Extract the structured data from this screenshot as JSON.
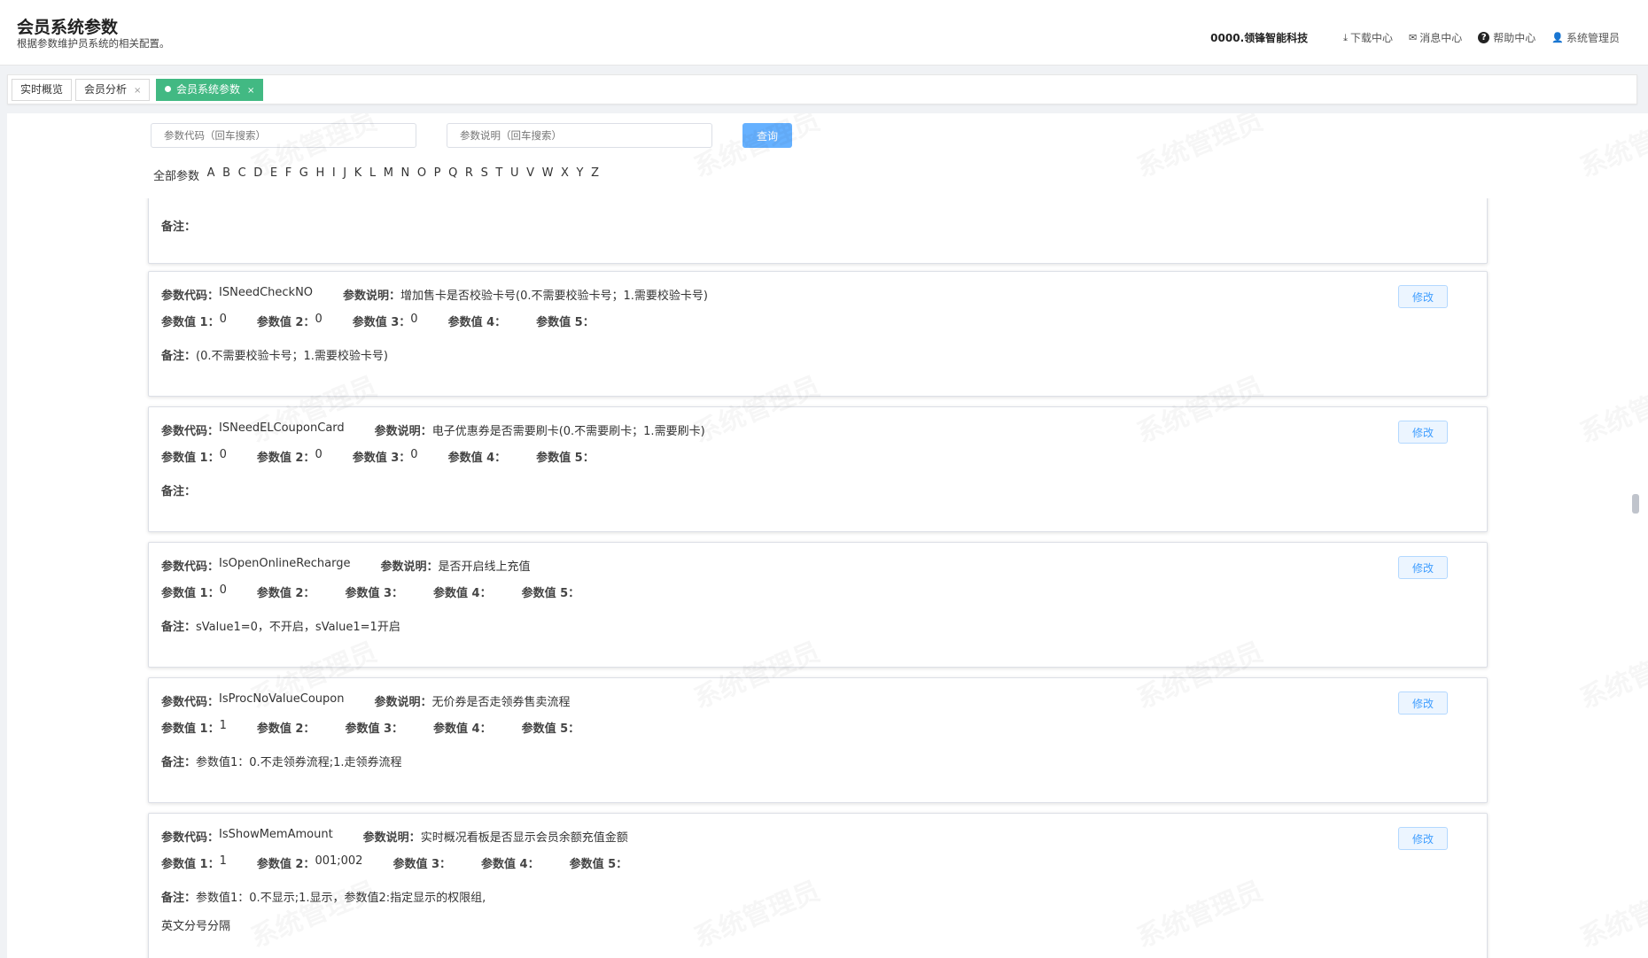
{
  "header": {
    "title": "会员系统参数",
    "subtitle": "根据参数维护员系统的相关配置。",
    "company": "0000.领锋智能科技",
    "download": "下载中心",
    "messages": "消息中心",
    "help": "帮助中心",
    "user": "系统管理员"
  },
  "tabs": [
    {
      "label": "实时概览"
    },
    {
      "label": "会员分析",
      "close": "×"
    },
    {
      "label": "会员系统参数",
      "close": "×"
    }
  ],
  "search": {
    "code_placeholder": "参数代码（回车搜索）",
    "desc_placeholder": "参数说明（回车搜索）",
    "button": "查询"
  },
  "alpha": [
    "全部参数",
    "A",
    "B",
    "C",
    "D",
    "E",
    "F",
    "G",
    "H",
    "I",
    "J",
    "K",
    "L",
    "M",
    "N",
    "O",
    "P",
    "Q",
    "R",
    "S",
    "T",
    "U",
    "V",
    "W",
    "X",
    "Y",
    "Z"
  ],
  "labels": {
    "code": "参数代码：",
    "desc": "参数说明：",
    "v1": "参数值 1：",
    "v2": "参数值 2：",
    "v3": "参数值 3：",
    "v4": "参数值 4：",
    "v5": "参数值 5：",
    "remark": "备注：",
    "edit": "修改"
  },
  "watermark": "系统管理员",
  "top_partial": {
    "remark": ""
  },
  "params": [
    {
      "code": "ISNeedCheckNO",
      "desc": "增加售卡是否校验卡号(0.不需要校验卡号；1.需要校验卡号)",
      "v1": "0",
      "v2": "0",
      "v3": "0",
      "v4": "",
      "v5": "",
      "remark": "(0.不需要校验卡号；1.需要校验卡号)",
      "remark2": ""
    },
    {
      "code": "ISNeedELCouponCard",
      "desc": "电子优惠券是否需要刷卡(0.不需要刷卡；1.需要刷卡)",
      "v1": "0",
      "v2": "0",
      "v3": "0",
      "v4": "",
      "v5": "",
      "remark": "",
      "remark2": ""
    },
    {
      "code": "IsOpenOnlineRecharge",
      "desc": "是否开启线上充值",
      "v1": "0",
      "v2": "",
      "v3": "",
      "v4": "",
      "v5": "",
      "remark": "sValue1=0，不开启，sValue1=1开启",
      "remark2": ""
    },
    {
      "code": "IsProcNoValueCoupon",
      "desc": "无价券是否走领券售卖流程",
      "v1": "1",
      "v2": "",
      "v3": "",
      "v4": "",
      "v5": "",
      "remark": "参数值1：0.不走领券流程;1.走领券流程",
      "remark2": ""
    },
    {
      "code": "IsShowMemAmount",
      "desc": "实时概况看板是否显示会员余额充值金额",
      "v1": "1",
      "v2": "001;002",
      "v3": "",
      "v4": "",
      "v5": "",
      "remark": "参数值1：0.不显示;1.显示，参数值2:指定显示的权限组,",
      "remark2": "英文分号分隔"
    }
  ]
}
